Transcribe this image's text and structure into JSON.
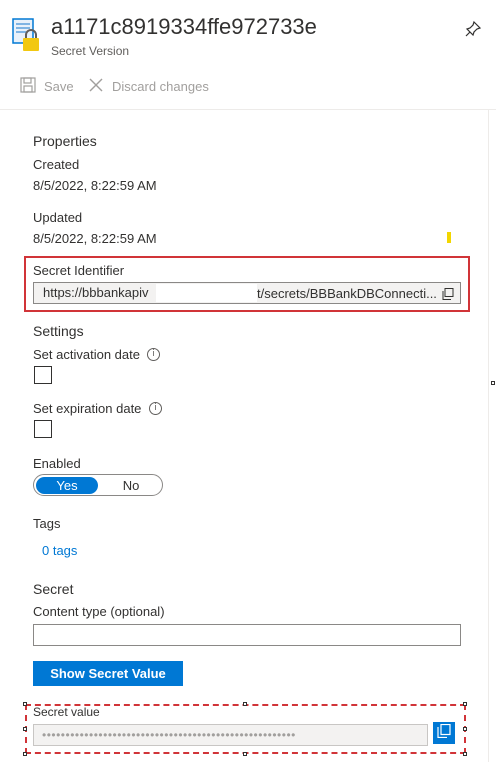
{
  "header": {
    "title": "a1171c8919334ffe972733e",
    "subtitle": "Secret Version",
    "icon": "key-vault-secret-icon",
    "pin_icon": "pin-icon"
  },
  "toolbar": {
    "save_label": "Save",
    "discard_label": "Discard changes"
  },
  "properties": {
    "section_title": "Properties",
    "created_label": "Created",
    "created_value": "8/5/2022, 8:22:59 AM",
    "updated_label": "Updated",
    "updated_value": "8/5/2022, 8:22:59 AM",
    "secret_identifier_label": "Secret Identifier",
    "secret_identifier_prefix": "https://bbbankapiv",
    "secret_identifier_suffix": "t/secrets/BBBankDBConnecti..."
  },
  "settings": {
    "section_title": "Settings",
    "activation_label": "Set activation date",
    "activation_checked": false,
    "expiration_label": "Set expiration date",
    "expiration_checked": false,
    "enabled_label": "Enabled",
    "enabled_yes": "Yes",
    "enabled_no": "No",
    "enabled_selected": "Yes",
    "tags_label": "Tags",
    "tags_link": "0 tags",
    "info_glyph": "i"
  },
  "secret": {
    "section_title": "Secret",
    "content_type_label": "Content type (optional)",
    "content_type_value": "",
    "show_button_label": "Show Secret Value",
    "secret_value_label": "Secret value",
    "secret_value_masked": "••••••••••••••••••••••••••••••••••••••••••••••••••••••"
  },
  "colors": {
    "accent": "#0078d4",
    "highlight_border": "#d13438",
    "text": "#323130",
    "disabled": "#a19f9d"
  }
}
